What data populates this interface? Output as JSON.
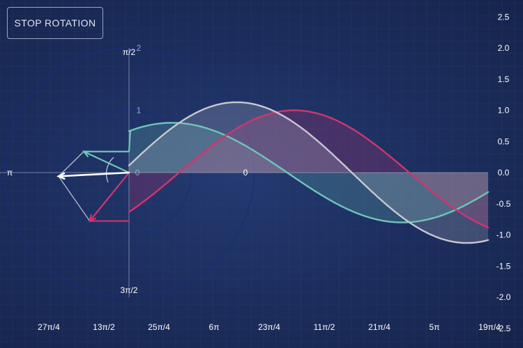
{
  "controls": {
    "stop_rotation_label": "STOP ROTATION"
  },
  "colors": {
    "background": "#1d2f60",
    "grid": "#2c4073",
    "teal": "#6cc7b8",
    "magenta": "#d2346e",
    "gray": "#c8c8d0",
    "resultant": "#ffffff",
    "axis": "#9aa6c4"
  },
  "polar": {
    "angle_labels": {
      "left": "π",
      "top": "π/2",
      "bottom": "3π/2",
      "right": "0"
    },
    "radius_labels": [
      "0",
      "1",
      "2"
    ],
    "radii": [
      1,
      2
    ]
  },
  "chart_data": {
    "type": "line",
    "xaxis": {
      "ticks": [
        "27π/4",
        "13π/2",
        "25π/4",
        "6π",
        "23π/4",
        "11π/2",
        "21π/4",
        "5π",
        "19π/4"
      ]
    },
    "yaxis": {
      "position": "right",
      "ylim": [
        -2.5,
        2.5
      ],
      "ticks": [
        "2.5",
        "2.0",
        "1.5",
        "1.0",
        "0.5",
        "0.0",
        "-0.5",
        "-1.0",
        "-1.5",
        "-2.0",
        "-2.5"
      ]
    },
    "series": [
      {
        "color": "teal",
        "amplitude": 0.8,
        "phase_display_deg": 155,
        "peak_x_fraction": 0.12,
        "end_value": -0.05
      },
      {
        "color": "magenta",
        "amplitude": 1.0,
        "phase_display_deg": 231,
        "peak_x_fraction": 0.46,
        "end_value": -0.95
      },
      {
        "color": "gray",
        "amplitude": 1.13,
        "phase_display_deg": 211,
        "peak_x_fraction": 0.3,
        "end_value": -1.05
      }
    ],
    "resultant_vector": {
      "amplitude": 1.13,
      "phase_display_deg": 183
    },
    "grid": true
  }
}
